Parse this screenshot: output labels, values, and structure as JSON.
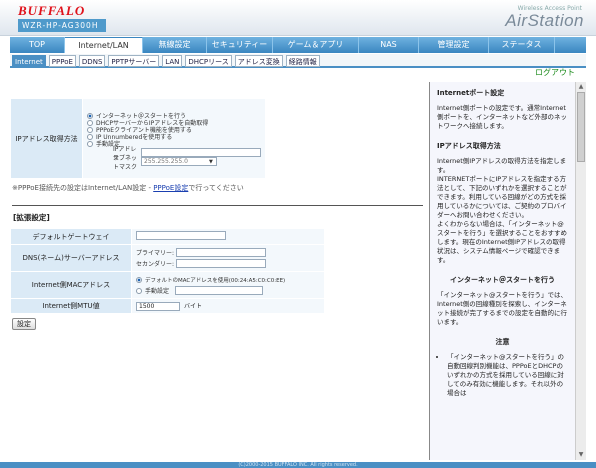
{
  "header": {
    "logo": "BUFFALO",
    "model": "WZR-HP-AG300H",
    "product_line": "Wireless Access Point",
    "product": "AirStation"
  },
  "nav": {
    "tabs": [
      {
        "label": "TOP",
        "w": 55
      },
      {
        "label": "Internet/LAN",
        "w": 78
      },
      {
        "label": "無線設定",
        "w": 64
      },
      {
        "label": "セキュリティー",
        "w": 66
      },
      {
        "label": "ゲーム＆アプリ",
        "w": 86
      },
      {
        "label": "NAS",
        "w": 60
      },
      {
        "label": "管理設定",
        "w": 70
      },
      {
        "label": "ステータス",
        "w": 66
      }
    ]
  },
  "subnav": {
    "tabs": [
      "Internet",
      "PPPoE",
      "DDNS",
      "PPTPサーバー",
      "LAN",
      "DHCPリース",
      "アドレス変換",
      "経路情報"
    ]
  },
  "logout": "ログアウト",
  "ipmethod": {
    "label": "IPアドレス取得方法",
    "options": [
      "インターネット＠スタートを行う",
      "DHCPサーバーからIPアドレスを自動取得",
      "PPPoEクライアント機能を使用する",
      "IP Unnumberedを使用する",
      "手動設定"
    ],
    "ip_label": "IPアドレス",
    "mask_label": "サブネットマスク",
    "mask_value": "255.255.255.0"
  },
  "note": {
    "prefix": "※PPPoE接続先の設定はInternet/LAN設定 - ",
    "link": "PPPoE設定",
    "suffix": "で行ってください"
  },
  "advanced": {
    "title": "[拡張設定]",
    "gateway_label": "デフォルトゲートウェイ",
    "dns_label": "DNS(ネーム)サーバーアドレス",
    "dns_primary": "プライマリー:",
    "dns_secondary": "セカンダリー:",
    "mac_label": "Internet側MACアドレス",
    "mac_default": "デフォルトのMACアドレスを使用(00:24:A5:C0:C0:EE)",
    "mac_manual": "手動設定",
    "mtu_label": "Internet側MTU値",
    "mtu_value": "1500",
    "mtu_unit": "バイト"
  },
  "save_button": "設定",
  "help": {
    "s1_title": "Internetポート設定",
    "s1_p": "Internet側ポートの設定です。通常Internet側ポートを、インターネットなど外部のネットワークへ接続します。",
    "s2_title": "IPアドレス取得方法",
    "s2_p1": "Internet側IPアドレスの取得方法を指定します。",
    "s2_p2": "INTERNETポートにIPアドレスを指定する方法として、下記のいずれかを選択することができます。利用している回線がどの方式を採用しているかについては、ご契約のプロバイダーへお問い合わせください。",
    "s2_p3": "よくわからない場合は、「インターネット@スタートを行う」を選択することをおすすめします。現在のInternet側IPアドレスの取得状況は、システム情報ページで確認できます。",
    "s3_title": "インターネット＠スタートを行う",
    "s3_p": "「インターネット@スタートを行う」では、Internet側の回線種別を探索し、インターネット接続が完了するまでの設定を自動的に行います。",
    "s4_title": "注意",
    "s4_li": "「インターネット@スタートを行う」の自動回線判別機能は、PPPoEとDHCPのいずれかの方式を採用している回線に対してのみ有効に機能します。それ以外の場合は"
  },
  "footer": "(C)2000-2015 BUFFALO INC. All rights reserved."
}
